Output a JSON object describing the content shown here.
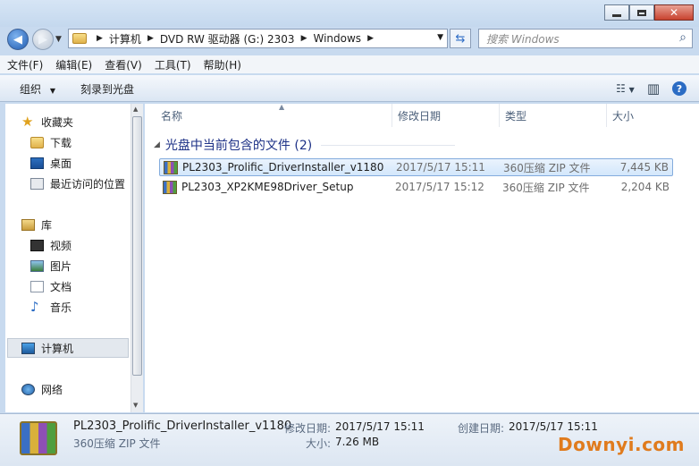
{
  "address": {
    "crumbs": [
      "计算机",
      "DVD RW 驱动器 (G:) 2303",
      "Windows"
    ],
    "search_placeholder": "搜索 Windows"
  },
  "menu": [
    "文件(F)",
    "编辑(E)",
    "查看(V)",
    "工具(T)",
    "帮助(H)"
  ],
  "commands": {
    "organize": "组织",
    "burn": "刻录到光盘"
  },
  "nav": {
    "favorites": "收藏夹",
    "downloads": "下载",
    "desktop": "桌面",
    "recent": "最近访问的位置",
    "libraries": "库",
    "videos": "视频",
    "pictures": "图片",
    "documents": "文档",
    "music": "音乐",
    "computer": "计算机",
    "network": "网络"
  },
  "columns": {
    "name": "名称",
    "date": "修改日期",
    "type": "类型",
    "size": "大小"
  },
  "group_title": "光盘中当前包含的文件 (2)",
  "files": [
    {
      "name": "PL2303_Prolific_DriverInstaller_v1180",
      "date": "2017/5/17 15:11",
      "type": "360压缩 ZIP 文件",
      "size": "7,445 KB"
    },
    {
      "name": "PL2303_XP2KME98Driver_Setup",
      "date": "2017/5/17 15:12",
      "type": "360压缩 ZIP 文件",
      "size": "2,204 KB"
    }
  ],
  "details": {
    "name": "PL2303_Prolific_DriverInstaller_v1180",
    "type": "360压缩 ZIP 文件",
    "modified_label": "修改日期:",
    "modified": "2017/5/17 15:11",
    "created_label": "创建日期:",
    "created": "2017/5/17 15:11",
    "size_label": "大小:",
    "size": "7.26 MB"
  },
  "watermark": "Downyi.com"
}
